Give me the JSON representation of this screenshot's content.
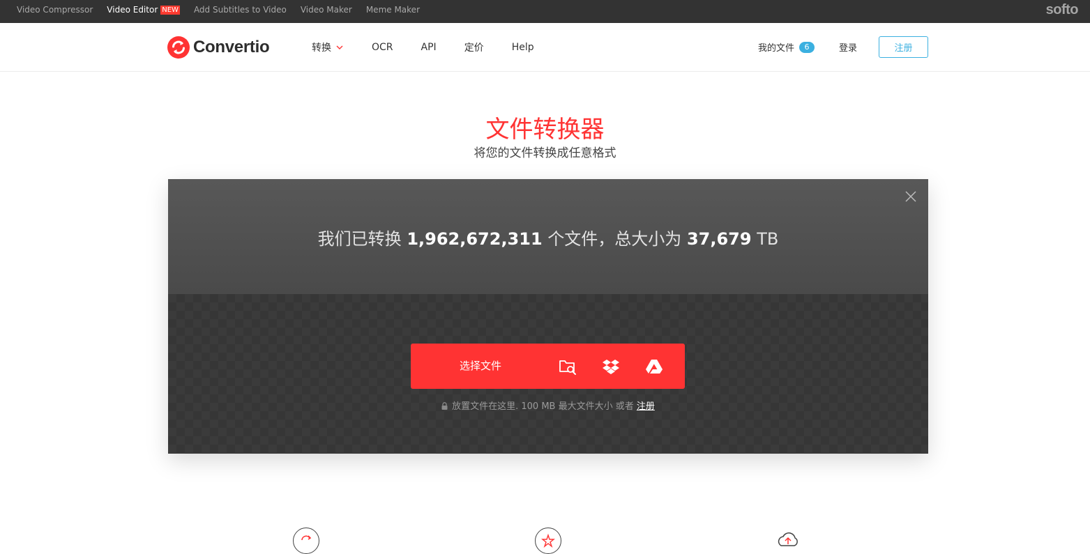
{
  "softo_bar": {
    "links": [
      {
        "label": "Video Compressor",
        "active": false
      },
      {
        "label": "Video Editor",
        "active": true,
        "badge": "NEW"
      },
      {
        "label": "Add Subtitles to Video",
        "active": false
      },
      {
        "label": "Video Maker",
        "active": false
      },
      {
        "label": "Meme Maker",
        "active": false
      }
    ],
    "brand": "softo"
  },
  "header": {
    "logo_text": "Convertio",
    "nav": {
      "convert": "转换",
      "ocr": "OCR",
      "api": "API",
      "pricing": "定价",
      "help": "Help"
    },
    "my_files_label": "我的文件",
    "my_files_count": "6",
    "login": "登录",
    "register": "注册"
  },
  "hero": {
    "title": "文件转换器",
    "subtitle": "将您的文件转换成任意格式"
  },
  "stats": {
    "prefix": "我们已转换",
    "files_count": "1,962,672,311",
    "middle": "个文件，总大小为",
    "total_size": "37,679",
    "unit": "TB"
  },
  "uploader": {
    "choose_label": "选择文件",
    "note_prefix": "放置文件在这里. 100 MB 最大文件大小 或者",
    "note_link": "注册"
  },
  "icons": {
    "close": "close-icon",
    "folder_search": "folder-search-icon",
    "dropbox": "dropbox-icon",
    "google_drive": "google-drive-icon",
    "lock": "lock-icon"
  },
  "colors": {
    "accent_red": "#ff3333",
    "accent_blue": "#3bb0e0",
    "top_bar": "#333333",
    "stats_panel": "#525252",
    "drop_panel": "#3b3b3b"
  }
}
